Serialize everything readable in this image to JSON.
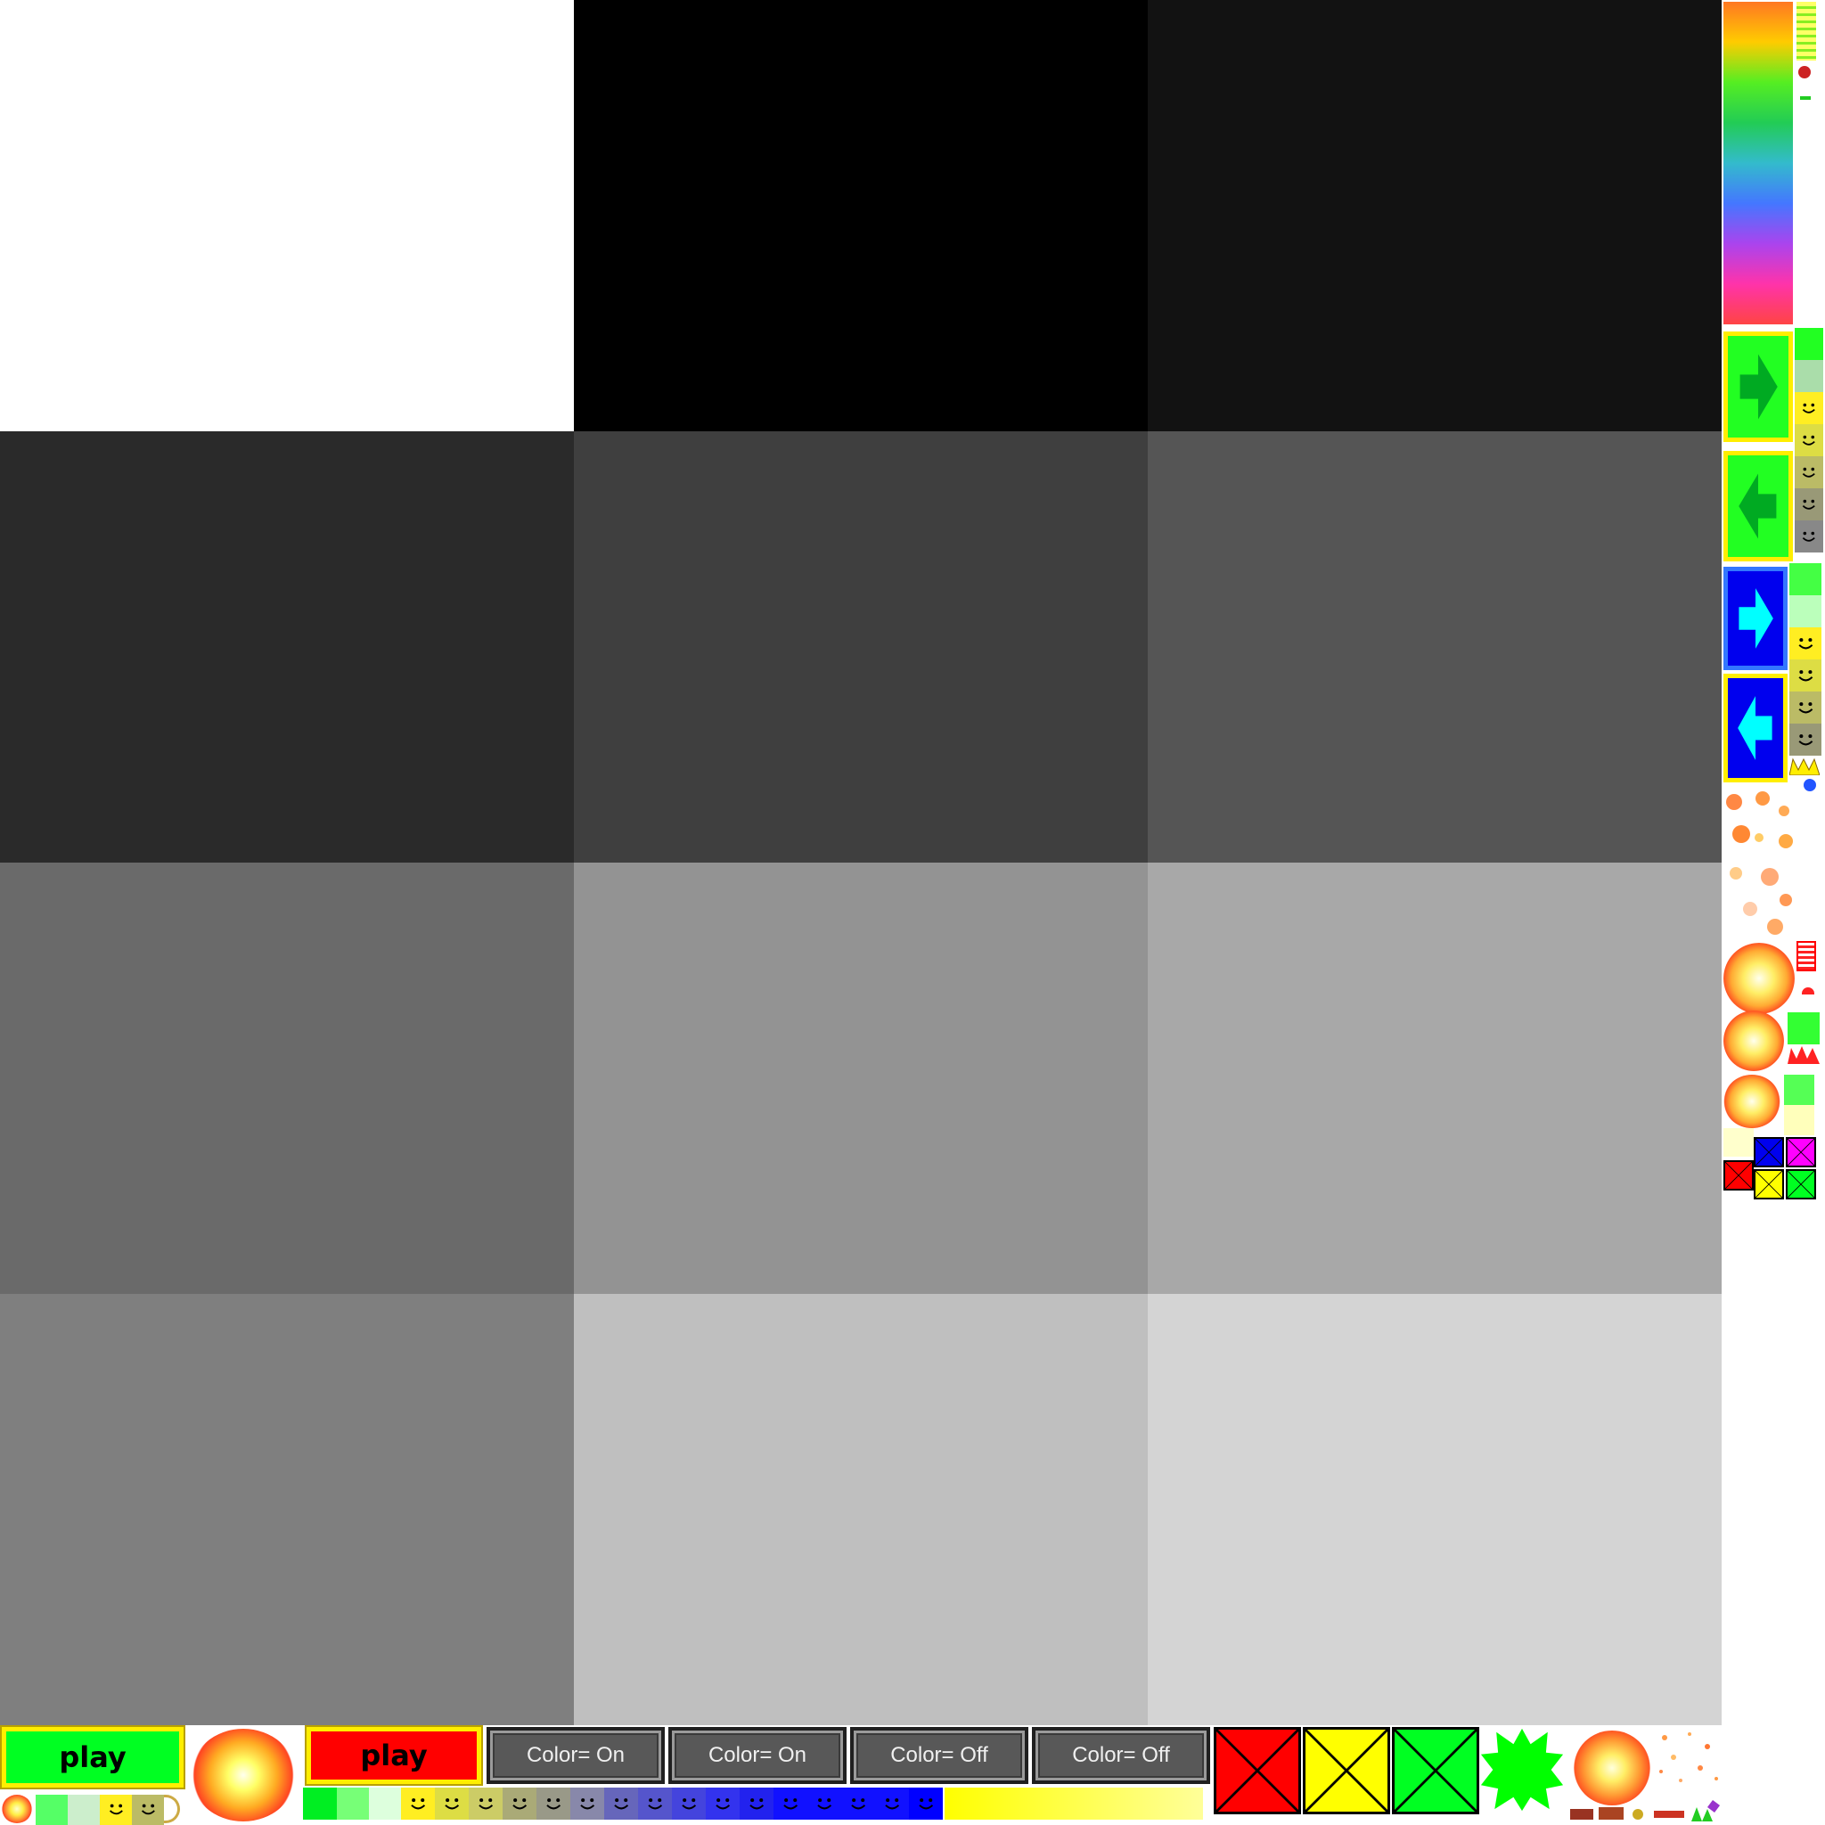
{
  "swatches": [
    {
      "color": "#ffffff"
    },
    {
      "color": "#000000"
    },
    {
      "color": "#121212"
    },
    {
      "color": "#2a2a2a"
    },
    {
      "color": "#3f3f3f"
    },
    {
      "color": "#555555"
    },
    {
      "color": "#6a6a6a"
    },
    {
      "color": "#939393"
    },
    {
      "color": "#a8a8a8"
    },
    {
      "color": "#7f7f7f"
    },
    {
      "color": "#bfbfbf"
    },
    {
      "color": "#d4d4d4"
    }
  ],
  "buttons": {
    "play_green": {
      "label": "play",
      "color": "#00ff22"
    },
    "play_red": {
      "label": "play",
      "color": "#ff0000"
    },
    "color_on_1": {
      "label": "Color= On"
    },
    "color_on_2": {
      "label": "Color= On"
    },
    "color_off_1": {
      "label": "Color= Off"
    },
    "color_off_2": {
      "label": "Color= Off"
    }
  },
  "crossed_boxes": [
    {
      "color": "#ff0000"
    },
    {
      "color": "#ffff00"
    },
    {
      "color": "#00ff22"
    }
  ],
  "small_crossed_boxes": [
    {
      "color": "#0000ee"
    },
    {
      "color": "#ff00ff"
    },
    {
      "color": "#ff0000"
    },
    {
      "color": "#ffff00"
    },
    {
      "color": "#00ff22"
    }
  ],
  "arrow_tiles": [
    {
      "icon": "right-arrow-icon",
      "bg": "#22ff22",
      "fg": "#00aa22",
      "border": "#ffee00"
    },
    {
      "icon": "left-arrow-icon",
      "bg": "#22ff22",
      "fg": "#00aa22",
      "border": "#ffee00"
    },
    {
      "icon": "right-arrow-icon",
      "bg": "#0000ee",
      "fg": "#00ffff",
      "border": "#3377ff"
    },
    {
      "icon": "left-arrow-icon",
      "bg": "#0000ee",
      "fg": "#00ffff",
      "border": "#ffee00"
    }
  ],
  "smiley_colors": [
    "#ffee22",
    "#dddd44",
    "#bbbb66",
    "#999977",
    "#888888"
  ],
  "bottom_strip_smileys": [
    "#ffee22",
    "#dddd44",
    "#cccc66",
    "#aaaa77",
    "#999988",
    "#8888aa",
    "#6666bb",
    "#5555cc",
    "#4444dd",
    "#3333ee",
    "#2222ee",
    "#1111ff",
    "#1111ff",
    "#1111ff",
    "#1111ff",
    "#0000ff"
  ],
  "rainbow": [
    "#ff7722",
    "#ffcc00",
    "#55ee22",
    "#22cc55",
    "#33bbcc",
    "#4477ff",
    "#aa44ee",
    "#ff33aa",
    "#ff4444"
  ]
}
